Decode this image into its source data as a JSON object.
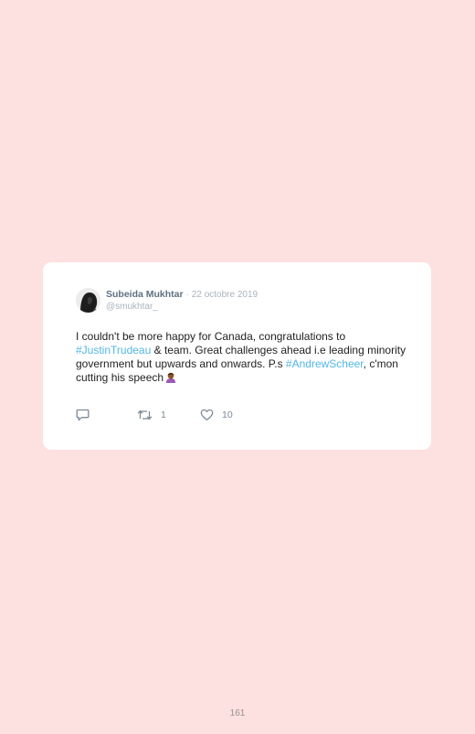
{
  "tweet": {
    "author_name": "Subeida Mukhtar",
    "separator": "·",
    "date": "22 octobre 2019",
    "handle": "@smukhtar_",
    "text_part1": "I couldn't be more happy for Canada, congratulations to ",
    "hashtag1": "#JustinTrudeau",
    "text_part2": " & team. Great challenges ahead i.e leading minority government but upwards and onwards. P.s ",
    "hashtag2": "#AndrewScheer",
    "text_part3": ", c'mon cutting his speech",
    "emoji": "person-facepalming-emoji",
    "retweet_count": "1",
    "like_count": "10"
  },
  "page": {
    "number": "161"
  },
  "colors": {
    "background": "#fde0e0",
    "card": "#ffffff",
    "hashtag": "#52b6e4",
    "meta": "#a9b4bc"
  }
}
